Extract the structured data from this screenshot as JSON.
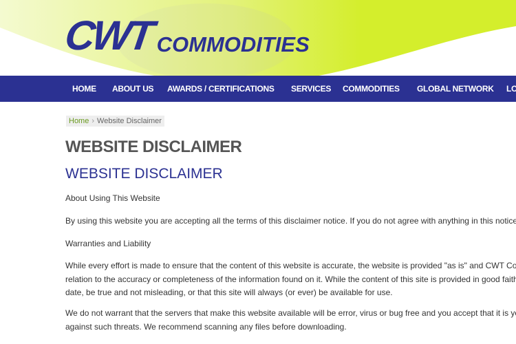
{
  "logo": {
    "mark": "CWT",
    "text": "COMMODITIES"
  },
  "colors": {
    "brand": "#2b3192",
    "accent_green": "#d4ee2c",
    "link_green": "#6a9a1f"
  },
  "nav": [
    "HOME",
    "ABOUT US",
    "AWARDS / CERTIFICATIONS",
    "SERVICES",
    "COMMODITIES",
    "GLOBAL NETWORK",
    "LO"
  ],
  "breadcrumb": {
    "home": "Home",
    "separator": "›",
    "current": "Website Disclaimer"
  },
  "page_title": "WEBSITE DISCLAIMER",
  "content": {
    "heading": "WEBSITE DISCLAIMER",
    "p1": [
      "About Using This Website"
    ],
    "p2": [
      "By using this website you are accepting all the terms of this disclaimer notice. If you do not agree with anything in this notice yo"
    ],
    "p3": [
      "Warranties and Liability"
    ],
    "p4": [
      "While every effort is made to ensure that the content of this website is accurate, the website is provided \"as is\" and CWT Comm",
      "relation to the accuracy or completeness of the information found on it. While the content of this site is provided in good faith",
      "date, be true and not misleading, or that this site will always (or ever) be available for use."
    ],
    "p5": [
      "We do not warrant that the servers that make this website available will be error, virus or bug free and you accept that it is you",
      "against such threats. We recommend scanning any files before downloading."
    ]
  }
}
